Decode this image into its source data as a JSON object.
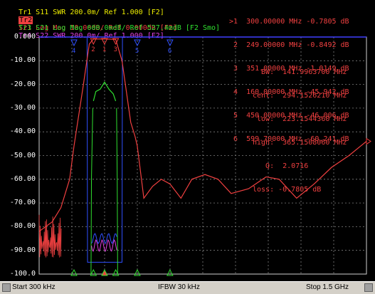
{
  "traces": [
    {
      "id": "Tr1",
      "text": "Tr1 S11 SWR 200.0m/ Ref 1.000 [F2]",
      "color": "#f0f000"
    },
    {
      "id": "Tr2",
      "text": "S21 Log Mag 10.00dB/ Ref 0.000dB [F2]",
      "tag": "Tr2",
      "color": "#f04040",
      "active": true
    },
    {
      "id": "Tr3",
      "text": "Tr3 S21 Log Mag 600.0mdB/ Ref 527.4mdB [F2 Smo]",
      "color": "#30e030"
    },
    {
      "id": "Tr4",
      "text": "Tr4 S22 SWR 200.0m/ Ref 1.000 [F2]",
      "color": "#e040e0"
    }
  ],
  "markers": [
    ">1  300.00000 MHz -0.7805 dB",
    " 2  249.00000 MHz -0.8492 dB",
    " 3  351.00000 MHz -1.0149 dB",
    " 4  160.00000 MHz -45.942 dB",
    " 5  450.00000 MHz -46.006 dB",
    " 6  599.70000 MHz -60.241 dB"
  ],
  "stats": [
    "  BW:  141.9963700 MHz",
    "cent:  294.1526210 MHz",
    " low:  223.1544360 MHz",
    "high:  365.1508060 MHz",
    "   Q:  2.0716",
    "loss: -0.7805 dB"
  ],
  "y_ticks": [
    "0.000",
    "-10.00",
    "-20.00",
    "-30.00",
    "-40.00",
    "-50.00",
    "-60.00",
    "-70.00",
    "-80.00",
    "-90.00",
    "-100.0"
  ],
  "chart_data": {
    "type": "line",
    "x_unit": "MHz",
    "xlim": [
      0.3,
      1500
    ],
    "ylim": [
      -100,
      0
    ],
    "y_unit": "dB",
    "series": [
      {
        "name": "Tr2 S21",
        "color": "#f04040",
        "x": [
          0.3,
          60,
          100,
          140,
          160,
          200,
          230,
          249,
          300,
          351,
          380,
          420,
          440,
          450,
          480,
          520,
          560,
          600,
          650,
          700,
          760,
          820,
          880,
          960,
          1040,
          1100,
          1180,
          1260,
          1340,
          1420,
          1500
        ],
        "y": [
          -82,
          -78,
          -72,
          -60,
          -46,
          -22,
          -3,
          -0.85,
          -0.78,
          -1.0,
          -10,
          -36,
          -42,
          -46,
          -68,
          -63,
          -60,
          -62,
          -68,
          -60,
          -58,
          -60,
          -66,
          -64,
          -59,
          -60,
          -68,
          -62,
          -55,
          -50,
          -44
        ]
      },
      {
        "name": "Tr3 S21",
        "color": "#30e030",
        "x": [
          249,
          260,
          280,
          300,
          320,
          340,
          351
        ],
        "y": [
          -27,
          -23,
          -22,
          -19,
          -22,
          -24,
          -27
        ]
      }
    ],
    "markers_x": [
      300,
      249,
      351,
      160,
      450,
      599.7
    ],
    "x_start_label": "Start 300 kHz",
    "x_stop_label": "Stop 1.5 GHz"
  },
  "status": {
    "start": "Start 300 kHz",
    "ifbw": "IFBW 30 kHz",
    "stop": "Stop 1.5 GHz"
  }
}
